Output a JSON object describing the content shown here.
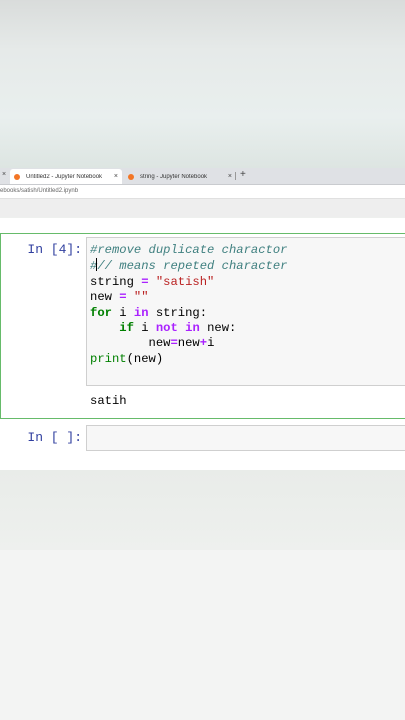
{
  "browser": {
    "tabs": [
      {
        "title": "Untitled2 - Jupyter Notebook",
        "close": "×"
      },
      {
        "title": "string - Jupyter Notebook",
        "close": "×"
      }
    ],
    "left_close": "×",
    "new_tab": "+",
    "address": "ebooks/satish/Untitled2.ipynb",
    "favicon_color": "#f37626"
  },
  "notebook": {
    "cells": [
      {
        "prompt": "In [4]:",
        "code": [
          "#remove duplicate charactor",
          "#// means repeted character",
          "string = \"satish\"",
          "new = \"\"",
          "for i in string:",
          "    if i not in new:",
          "        new=new+i",
          "print(new)"
        ],
        "output": "satih"
      },
      {
        "prompt": "In [ ]:",
        "code": []
      }
    ],
    "selected_border_color": "#66bb6a",
    "prompt_color": "#303f9f"
  }
}
